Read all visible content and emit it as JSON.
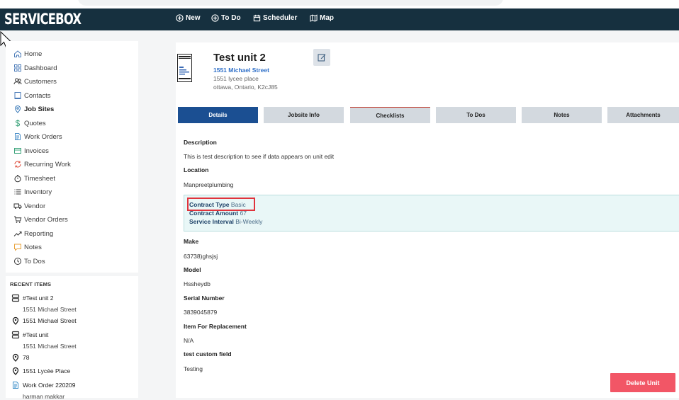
{
  "app": {
    "logo": "SERVICEBOX",
    "nav": [
      {
        "label": "New",
        "icon": "plus-circle-icon"
      },
      {
        "label": "To Do",
        "icon": "plus-circle-icon"
      },
      {
        "label": "Scheduler",
        "icon": "calendar-icon"
      },
      {
        "label": "Map",
        "icon": "map-icon"
      }
    ]
  },
  "sidebar": {
    "items": [
      {
        "label": "Home",
        "icon": "home-icon"
      },
      {
        "label": "Dashboard",
        "icon": "dashboard-icon"
      },
      {
        "label": "Customers",
        "icon": "customers-icon"
      },
      {
        "label": "Contacts",
        "icon": "contacts-icon"
      },
      {
        "label": "Job Sites",
        "icon": "location-pin-icon"
      },
      {
        "label": "Quotes",
        "icon": "dollar-icon"
      },
      {
        "label": "Work Orders",
        "icon": "document-icon"
      },
      {
        "label": "Invoices",
        "icon": "invoice-icon"
      },
      {
        "label": "Recurring Work",
        "icon": "recurring-icon"
      },
      {
        "label": "Timesheet",
        "icon": "stopwatch-icon"
      },
      {
        "label": "Inventory",
        "icon": "list-icon"
      },
      {
        "label": "Vendor",
        "icon": "truck-icon"
      },
      {
        "label": "Vendor Orders",
        "icon": "cart-icon"
      },
      {
        "label": "Reporting",
        "icon": "trend-icon"
      },
      {
        "label": "Notes",
        "icon": "note-icon"
      },
      {
        "label": "To Dos",
        "icon": "clock-icon"
      }
    ],
    "active": "Job Sites"
  },
  "recent": {
    "title": "RECENT ITEMS",
    "items": [
      {
        "label": "#Test unit 2",
        "sub": "1551 Michael Street",
        "icon": "unit-icon"
      },
      {
        "label": "1551 Michael Street",
        "sub": "",
        "icon": "location-pin-icon"
      },
      {
        "label": "#Test unit",
        "sub": "1551 Michael Street",
        "icon": "unit-icon"
      },
      {
        "label": "78",
        "sub": "",
        "icon": "location-pin-icon"
      },
      {
        "label": "1551 Lycée Place",
        "sub": "",
        "icon": "location-pin-icon"
      },
      {
        "label": "Work Order 220209",
        "sub": "harman makkar",
        "icon": "document-icon"
      }
    ]
  },
  "unit": {
    "title": "Test unit 2",
    "address_link": "1551 Michael Street",
    "address_line1": "1551 lycee place",
    "address_line2": "ottawa, Ontario, K2cJ85"
  },
  "tabs": [
    {
      "label": "Details",
      "active": true
    },
    {
      "label": "Jobsite Info",
      "active": false
    },
    {
      "label": "Checklists",
      "active": false
    },
    {
      "label": "To Dos",
      "active": false
    },
    {
      "label": "Notes",
      "active": false
    },
    {
      "label": "Attachments",
      "active": false
    }
  ],
  "details": {
    "description_label": "Description",
    "description_value": "This is test description to see if data appears on unit edit",
    "location_label": "Location",
    "location_value": "Manpreetplumbing",
    "contract": {
      "type_label": "Contract Type",
      "type_value": "Basic",
      "amount_label": "Contract Amount",
      "amount_value": "67",
      "interval_label": "Service Interval",
      "interval_value": "Bi-Weekly"
    },
    "make_label": "Make",
    "make_value": "63738)ghsjsj",
    "model_label": "Model",
    "model_value": "Hssheydb",
    "serial_label": "Serial Number",
    "serial_value": "3839045879",
    "replacement_label": "Item For Replacement",
    "replacement_value": "N/A",
    "custom_label": "test custom field",
    "custom_value": "Testing"
  },
  "actions": {
    "delete_label": "Delete Unit"
  },
  "colors": {
    "navbar": "#16303f",
    "active_tab": "#1b4f92",
    "delete": "#f25666",
    "highlight": "#e0333c",
    "link": "#2e6fc8"
  }
}
